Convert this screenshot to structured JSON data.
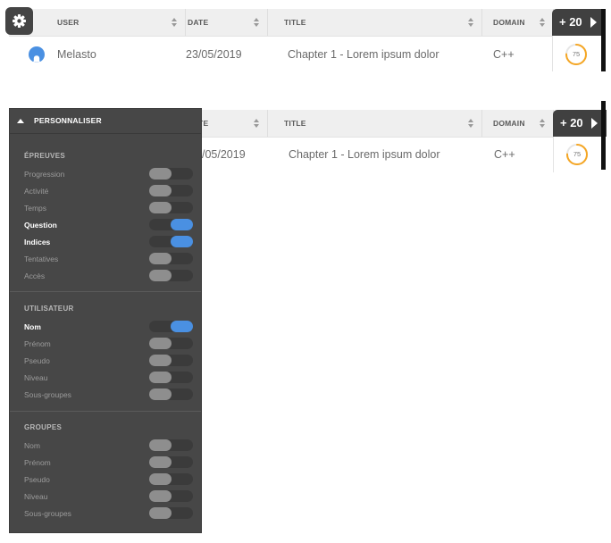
{
  "table": {
    "columns": [
      "USER",
      "DATE",
      "TITLE",
      "DOMAIN"
    ],
    "more_label": "+ 20",
    "row": {
      "user": "Melasto",
      "date": "23/05/2019",
      "title": "Chapter 1 - Lorem ipsum dolor",
      "domain": "C++",
      "score": "75",
      "score_fraction": 0.75
    },
    "row_partial_date": "/05/2019"
  },
  "panel": {
    "title": "PERSONNALISER",
    "sections": [
      {
        "title": "ÉPREUVES",
        "options": [
          {
            "label": "Progression",
            "on": false
          },
          {
            "label": "Activité",
            "on": false
          },
          {
            "label": "Temps",
            "on": false
          },
          {
            "label": "Question",
            "on": true
          },
          {
            "label": "Indices",
            "on": true
          },
          {
            "label": "Tentatives",
            "on": false
          },
          {
            "label": "Accès",
            "on": false
          }
        ]
      },
      {
        "title": "UTILISATEUR",
        "options": [
          {
            "label": "Nom",
            "on": true
          },
          {
            "label": "Prénom",
            "on": false
          },
          {
            "label": "Pseudo",
            "on": false
          },
          {
            "label": "Niveau",
            "on": false
          },
          {
            "label": "Sous-groupes",
            "on": false
          }
        ]
      },
      {
        "title": "GROUPES",
        "options": [
          {
            "label": "Nom",
            "on": false
          },
          {
            "label": "Prénom",
            "on": false
          },
          {
            "label": "Pseudo",
            "on": false
          },
          {
            "label": "Niveau",
            "on": false
          },
          {
            "label": "Sous-groupes",
            "on": false
          }
        ]
      }
    ]
  },
  "colors": {
    "accent": "#4a90e2",
    "dark": "#444444",
    "gauge": "#f5a623"
  },
  "icons": {
    "settings": "gear-icon",
    "more": "play-arrow-icon",
    "avatar": "user-bell-icon",
    "collapse": "caret-up-icon"
  }
}
